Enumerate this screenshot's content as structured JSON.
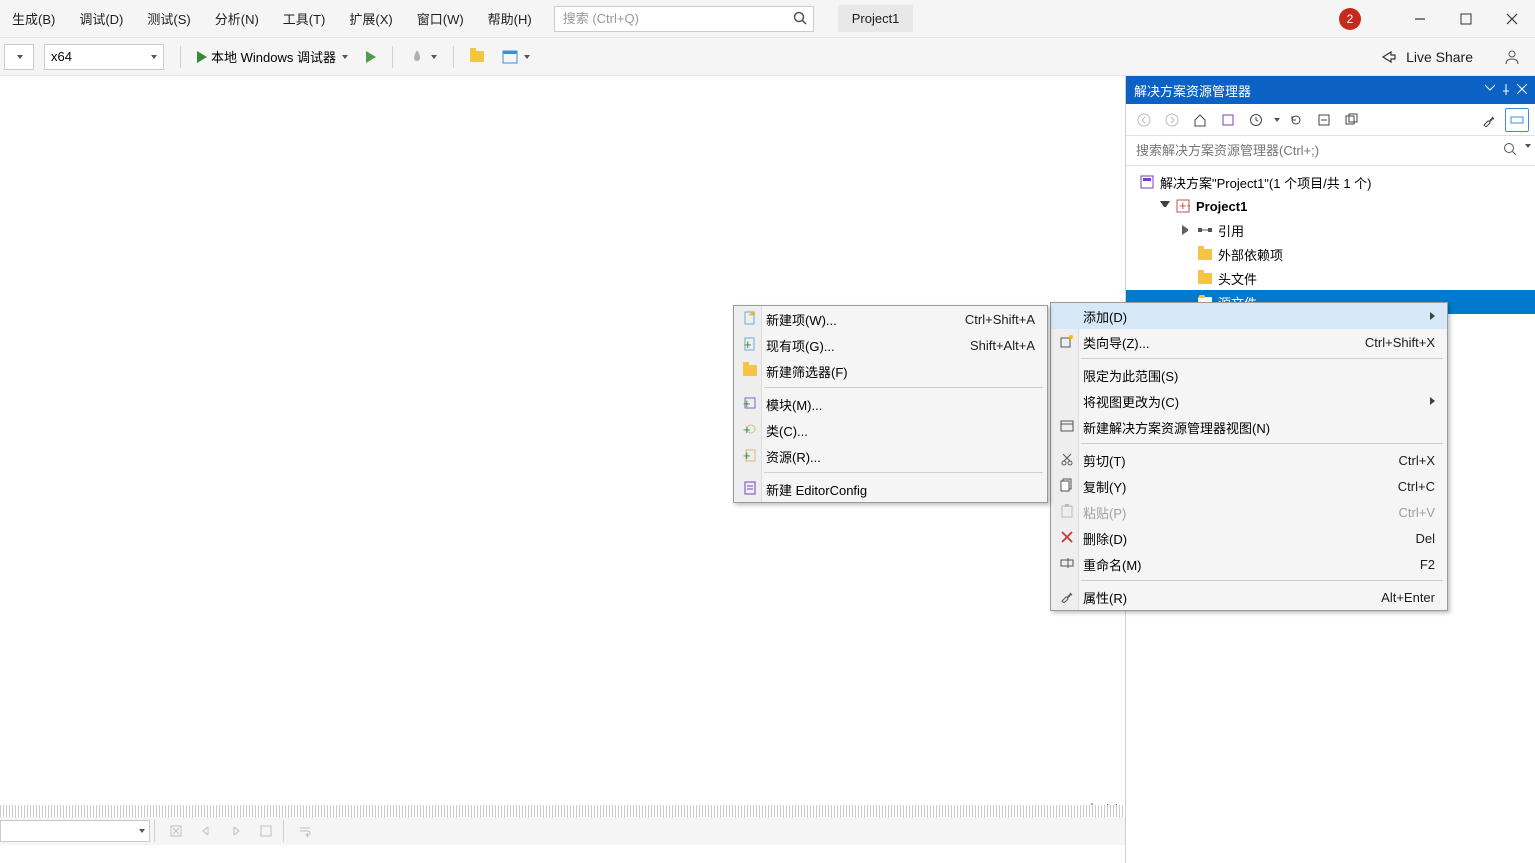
{
  "menu": {
    "items": [
      "生成(B)",
      "调试(D)",
      "测试(S)",
      "分析(N)",
      "工具(T)",
      "扩展(X)",
      "窗口(W)",
      "帮助(H)"
    ]
  },
  "search": {
    "placeholder": "搜索 (Ctrl+Q)"
  },
  "project_label": "Project1",
  "notif_count": "2",
  "toolbar": {
    "arch": "x64",
    "debugger_label": "本地 Windows 调试器",
    "live_share": "Live Share"
  },
  "se": {
    "title": "解决方案资源管理器",
    "search_placeholder": "搜索解决方案资源管理器(Ctrl+;)",
    "sln": "解决方案\"Project1\"(1 个项目/共 1 个)",
    "proj": "Project1",
    "refs": "引用",
    "ext_deps": "外部依赖项",
    "headers": "头文件",
    "sources": "源文件"
  },
  "ctx1": {
    "add": "添加(D)",
    "class_wizard": "类向导(Z)...",
    "class_wizard_sc": "Ctrl+Shift+X",
    "scope": "限定为此范围(S)",
    "change_view": "将视图更改为(C)",
    "new_explorer": "新建解决方案资源管理器视图(N)",
    "cut": "剪切(T)",
    "cut_sc": "Ctrl+X",
    "copy": "复制(Y)",
    "copy_sc": "Ctrl+C",
    "paste": "粘贴(P)",
    "paste_sc": "Ctrl+V",
    "delete": "删除(D)",
    "delete_sc": "Del",
    "rename": "重命名(M)",
    "rename_sc": "F2",
    "props": "属性(R)",
    "props_sc": "Alt+Enter"
  },
  "ctx2": {
    "new_item": "新建项(W)...",
    "new_item_sc": "Ctrl+Shift+A",
    "existing": "现有项(G)...",
    "existing_sc": "Shift+Alt+A",
    "new_filter": "新建筛选器(F)",
    "module": "模块(M)...",
    "klass": "类(C)...",
    "resource": "资源(R)...",
    "editorconfig": "新建 EditorConfig"
  }
}
